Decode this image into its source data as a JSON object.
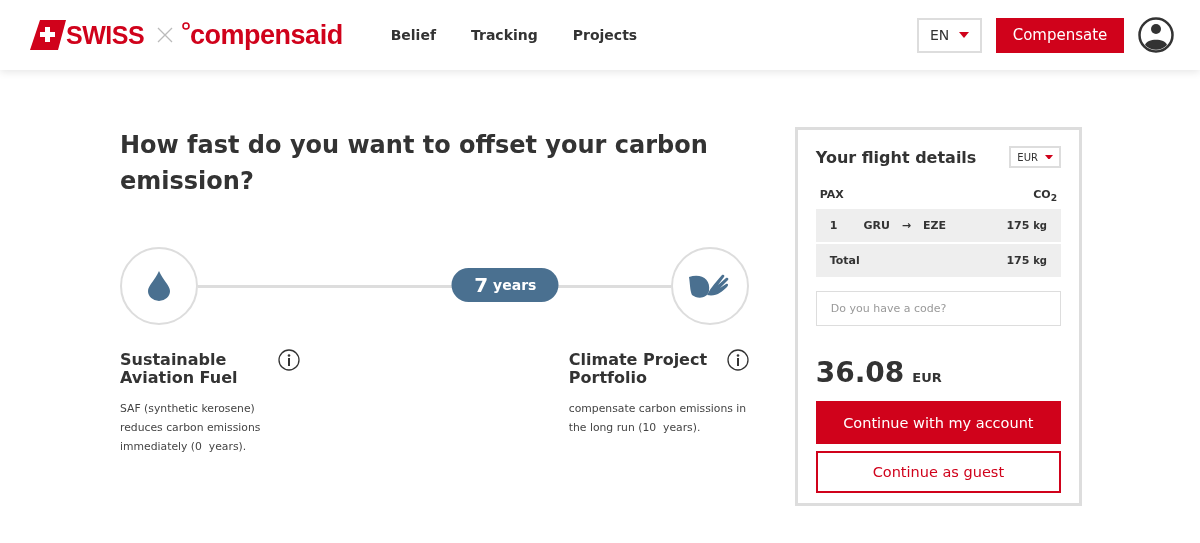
{
  "header": {
    "brand": "SWISS",
    "partner": "compensaid",
    "nav": [
      {
        "label": "Belief"
      },
      {
        "label": "Tracking"
      },
      {
        "label": "Projects"
      }
    ],
    "language": "EN",
    "cta": "Compensate"
  },
  "question": "How fast do you want to offset your carbon emission?",
  "slider": {
    "value": "7",
    "unit": "years",
    "level": 0.65
  },
  "options": [
    {
      "kind": "fuel",
      "title": "Sustainable Aviation Fuel",
      "text": "SAF (synthetic kerosene) reduces carbon emissions immediately (0  years)."
    },
    {
      "kind": "projects",
      "title": "Climate Project Portfolio",
      "text": "compensate carbon emissions in the long run (10  years)."
    }
  ],
  "card": {
    "title": "Your flight details",
    "currency": "EUR",
    "col_pax": "PAX",
    "col_co2": "CO$_{2}$",
    "rows": [
      {
        "pax": "1",
        "from": "GRU",
        "arrow": "→",
        "to": "EZE",
        "amount": "175",
        "unit": "kg"
      }
    ],
    "total": {
      "label": "Total",
      "amount": "175",
      "unit": "kg"
    },
    "code_placeholder": "Do you have a code?",
    "price": "36.08",
    "price_currency": "EUR",
    "primary": "Continue with my account",
    "secondary": "Continue as guest"
  }
}
